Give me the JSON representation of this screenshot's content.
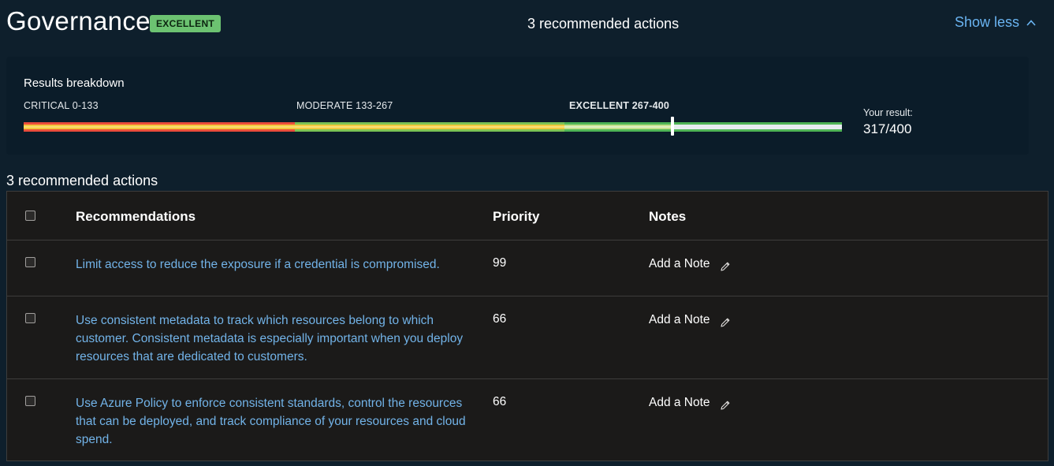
{
  "header": {
    "title": "Governance",
    "badge": "EXCELLENT",
    "count_label": "3 recommended actions",
    "show_less": "Show less"
  },
  "breakdown": {
    "title": "Results breakdown",
    "segments": [
      {
        "label": "CRITICAL 0-133",
        "min": 0,
        "max": 133
      },
      {
        "label": "MODERATE 133-267",
        "min": 133,
        "max": 267
      },
      {
        "label": "EXCELLENT 267-400",
        "min": 267,
        "max": 400
      }
    ],
    "your_result_label": "Your result:",
    "your_result_value": "317/400",
    "score": 317,
    "max_score": 400
  },
  "actions": {
    "title": "3 recommended actions",
    "columns": {
      "recommendations": "Recommendations",
      "priority": "Priority",
      "notes": "Notes"
    },
    "rows": [
      {
        "recommendation": "Limit access to reduce the exposure if a credential is compromised.",
        "priority": "99",
        "note": "Add a Note"
      },
      {
        "recommendation": "Use consistent metadata to track which resources belong to which customer. Consistent metadata is especially important when you deploy resources that are dedicated to customers.",
        "priority": "66",
        "note": "Add a Note"
      },
      {
        "recommendation": "Use Azure Policy to enforce consistent standards, control the resources that can be deployed, and track compliance of your resources and cloud spend.",
        "priority": "66",
        "note": "Add a Note"
      }
    ]
  },
  "colors": {
    "background": "#0e1f2c",
    "link": "#72b3e8",
    "badge": "#6cc271",
    "table_bg": "#1b1a19"
  },
  "icons": {
    "show_less": "chevron-up-icon",
    "note": "pencil-icon"
  }
}
